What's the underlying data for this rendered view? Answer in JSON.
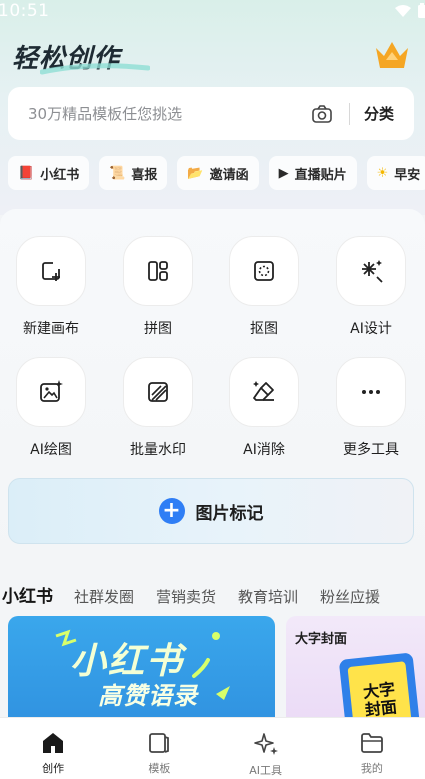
{
  "status_bar": {
    "time": "10:51"
  },
  "header": {
    "title": "轻松创作",
    "crown_icon": "crown-icon"
  },
  "search": {
    "placeholder": "30万精品模板任您挑选",
    "category_label": "分类",
    "camera_icon": "camera-icon"
  },
  "chips": [
    {
      "label": "小红书",
      "icon": "📕"
    },
    {
      "label": "喜报",
      "icon": "📜"
    },
    {
      "label": "邀请函",
      "icon": "📂"
    },
    {
      "label": "直播贴片",
      "icon": "▶"
    },
    {
      "label": "早安",
      "icon": "☀"
    }
  ],
  "tools": [
    {
      "label": "新建画布",
      "icon": "new-canvas-icon"
    },
    {
      "label": "拼图",
      "icon": "collage-icon"
    },
    {
      "label": "抠图",
      "icon": "cutout-icon"
    },
    {
      "label": "AI设计",
      "icon": "ai-sparkle-icon"
    },
    {
      "label": "AI绘图",
      "icon": "ai-image-icon"
    },
    {
      "label": "批量水印",
      "icon": "watermark-icon"
    },
    {
      "label": "AI消除",
      "icon": "eraser-icon"
    },
    {
      "label": "更多工具",
      "icon": "more-icon"
    }
  ],
  "image_mark": {
    "label": "图片标记"
  },
  "category_tabs": [
    {
      "label": "小红书",
      "active": true
    },
    {
      "label": "社群发圈"
    },
    {
      "label": "营销卖货"
    },
    {
      "label": "教育培训"
    },
    {
      "label": "粉丝应援"
    }
  ],
  "cards": [
    {
      "big_text": "小红书",
      "sub_text": "高赞语录"
    },
    {
      "title": "大字封面",
      "poster_line1": "大字",
      "poster_line2": "封面"
    }
  ],
  "bottom_nav": [
    {
      "label": "创作",
      "active": true
    },
    {
      "label": "模板"
    },
    {
      "label": "AI工具"
    },
    {
      "label": "我的"
    }
  ],
  "colors": {
    "accent": "#2f7ef5",
    "crown": "#f5a623",
    "card_blue": "#3aa7ec"
  }
}
